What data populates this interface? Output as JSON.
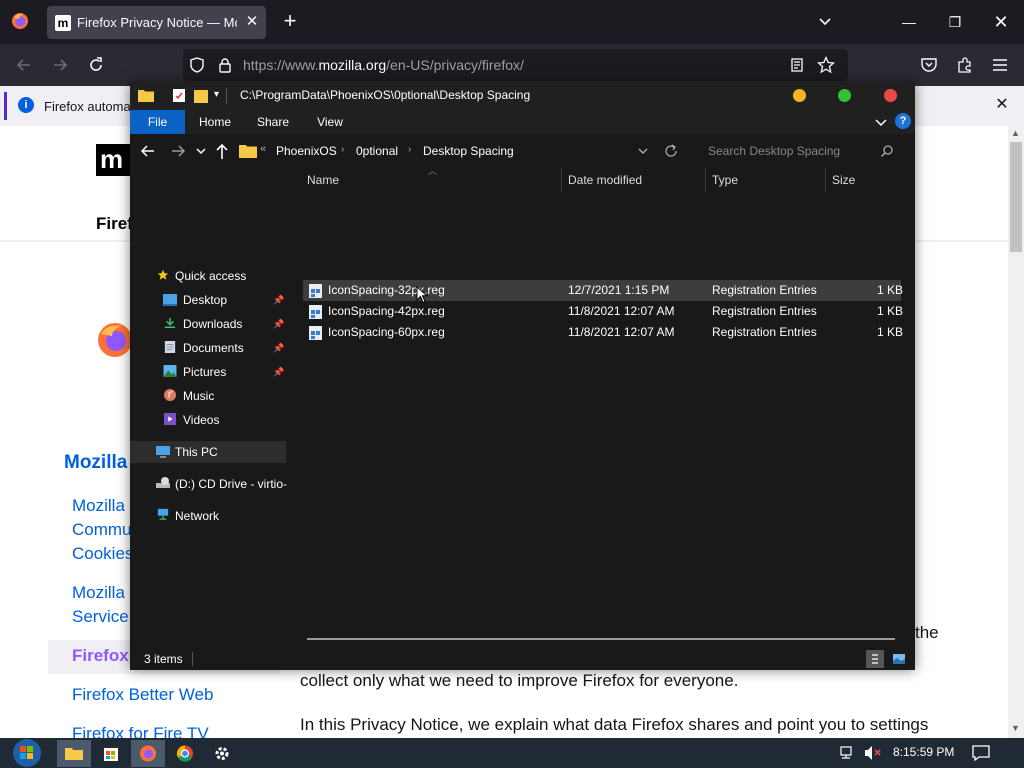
{
  "firefox": {
    "tab_title": "Firefox Privacy Notice — Mozill",
    "tab_favicon": "m",
    "url_prefix": "https://www.",
    "url_domain": "mozilla.org",
    "url_path": "/en-US/privacy/firefox/",
    "notification": "Firefox automati"
  },
  "page": {
    "logo_text": "m",
    "partial_heading": "Firef",
    "sidebar_heading": "Mozilla",
    "links": [
      "Mozilla",
      "Commu",
      "Cookies",
      "Mozilla",
      "Service"
    ],
    "current_link": "Firefox",
    "link_better_web": "Firefox Better Web",
    "link_fire_tv": "Firefox for Fire TV",
    "body_fragment": "the",
    "body_line1": "collect only what we need to improve Firefox for everyone.",
    "body_line2": "In this Privacy Notice, we explain what data Firefox shares and point you to settings"
  },
  "explorer": {
    "title_path": "C:\\ProgramData\\PhoenixOS\\0ptional\\Desktop Spacing",
    "ribbon_tabs": [
      "File",
      "Home",
      "Share",
      "View"
    ],
    "breadcrumb": [
      "PhoenixOS",
      "0ptional",
      "Desktop Spacing"
    ],
    "search_placeholder": "Search Desktop Spacing",
    "nav": {
      "quick_access": "Quick access",
      "desktop": "Desktop",
      "downloads": "Downloads",
      "documents": "Documents",
      "pictures": "Pictures",
      "music": "Music",
      "videos": "Videos",
      "this_pc": "This PC",
      "cd_drive": "(D:) CD Drive - virtio-",
      "network": "Network"
    },
    "columns": {
      "name": "Name",
      "date": "Date modified",
      "type": "Type",
      "size": "Size"
    },
    "files": [
      {
        "name": "IconSpacing-32px.reg",
        "date": "12/7/2021 1:15 PM",
        "type": "Registration Entries",
        "size": "1 KB"
      },
      {
        "name": "IconSpacing-42px.reg",
        "date": "11/8/2021 12:07 AM",
        "type": "Registration Entries",
        "size": "1 KB"
      },
      {
        "name": "IconSpacing-60px.reg",
        "date": "11/8/2021 12:07 AM",
        "type": "Registration Entries",
        "size": "1 KB"
      }
    ],
    "status": "3 items",
    "colors": {
      "close": "#e94848",
      "minimize": "#f5b520",
      "maximize": "#33c233",
      "accent": "#0b62c5"
    }
  },
  "taskbar": {
    "clock": "8:15:59 PM"
  }
}
